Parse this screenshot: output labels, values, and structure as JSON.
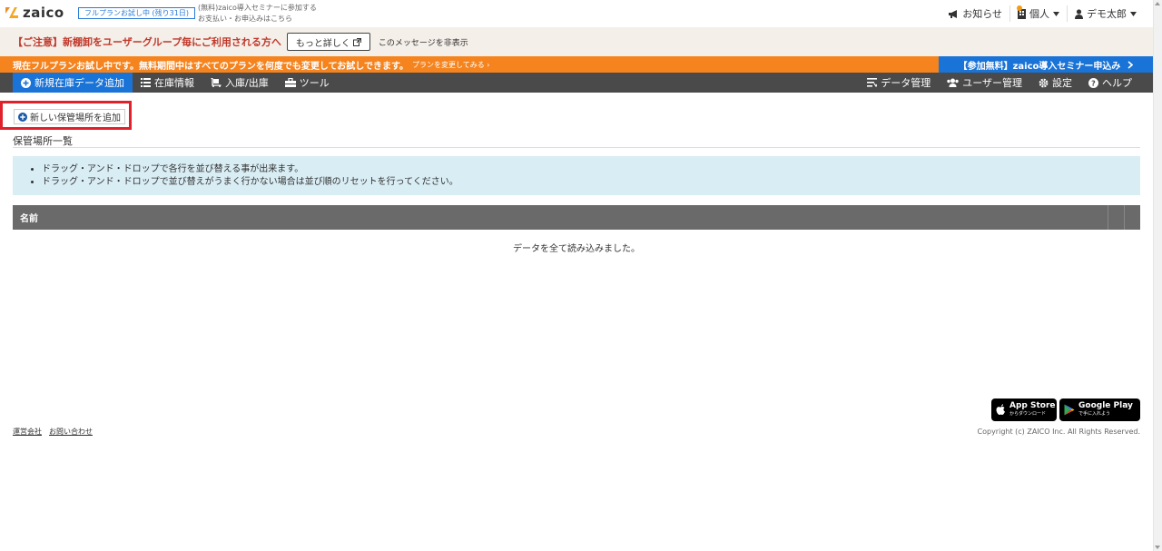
{
  "header": {
    "logo_text": "zaico",
    "trial_badge": "フルプランお試し中 (残り31日)",
    "link_seminar": "(無料)zaico導入セミナーに参加する",
    "link_payment": "お支払い・お申込みはこちら",
    "notice": "お知らせ",
    "account_type": "個人",
    "user_name": "デモ太郎"
  },
  "warning_bar": {
    "text": "【ご注意】新棚卸をユーザーグループ毎にご利用される方へ",
    "more_button": "もっと詳しく",
    "hide_link": "このメッセージを非表示"
  },
  "orange_bar": {
    "text": "現在フルプランお試し中です。無料期間中はすべてのプランを何度でも変更してお試しできます。",
    "link": "プランを変更してみる ›",
    "seminar_button": "【参加無料】zaico導入セミナー申込み"
  },
  "nav": {
    "add_item": "新規在庫データ追加",
    "inventory_info": "在庫情報",
    "in_out": "入庫/出庫",
    "tools": "ツール",
    "data_management": "データ管理",
    "user_management": "ユーザー管理",
    "settings": "設定",
    "help": "ヘルプ"
  },
  "content": {
    "add_location_button": "新しい保管場所を追加",
    "section_title": "保管場所一覧",
    "info_items": [
      "ドラッグ・アンド・ドロップで各行を並び替える事が出来ます。",
      "ドラッグ・アンド・ドロップで並び替えがうまく行かない場合は並び順のリセットを行ってください。"
    ],
    "table_header_name": "名前",
    "loaded_message": "データを全て読み込みました。"
  },
  "footer": {
    "app_store_sub": "からダウンロード",
    "app_store_main": "App Store",
    "google_play_main": "Google Play",
    "google_play_sub": "で手に入れよう",
    "link_company": "運営会社",
    "link_contact": "お問い合わせ",
    "copyright": "Copyright (c) ZAICO Inc. All Rights Reserved."
  },
  "colors": {
    "accent_blue": "#1a73d6",
    "orange": "#f5841f",
    "nav_dark": "#4a4a4a",
    "warning_red": "#c0392b",
    "highlight_red": "#e0202a",
    "info_bg": "#d9edf4"
  }
}
